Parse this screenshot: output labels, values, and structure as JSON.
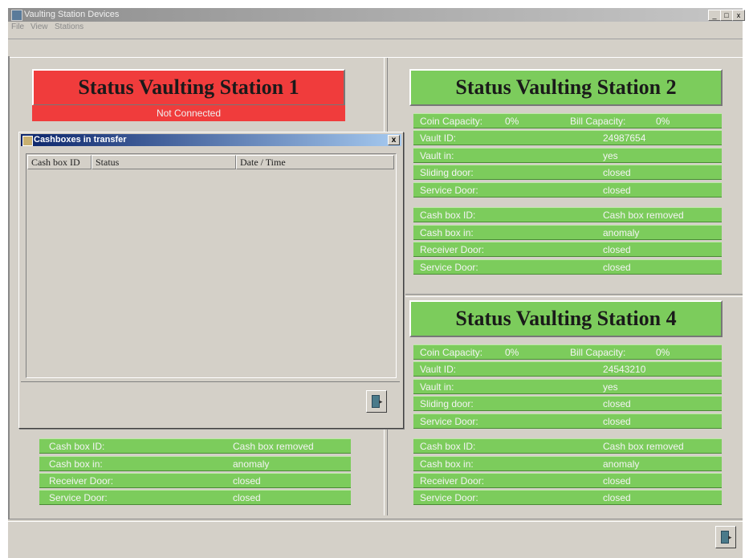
{
  "window": {
    "title": "Vaulting Station Devices",
    "controls": [
      "_",
      "□",
      "x"
    ]
  },
  "menu": [
    "File",
    "View",
    "Stations"
  ],
  "station1": {
    "header": "Status Vaulting Station 1",
    "status": "Not Connected",
    "rows": [
      {
        "label": "Cash box ID:",
        "value": "Cash box removed"
      },
      {
        "label": "Cash box in:",
        "value": "anomaly"
      },
      {
        "label": "Receiver Door:",
        "value": "closed"
      },
      {
        "label": "Service Door:",
        "value": "closed"
      }
    ]
  },
  "station2": {
    "header": "Status Vaulting Station 2",
    "capacity": {
      "coin_label": "Coin Capacity:",
      "coin_value": "0%",
      "bill_label": "Bill Capacity:",
      "bill_value": "0%"
    },
    "vault_rows": [
      {
        "label": "Vault ID:",
        "value": "24987654"
      },
      {
        "label": "Vault in:",
        "value": "yes"
      },
      {
        "label": "Sliding door:",
        "value": "closed"
      },
      {
        "label": "Service Door:",
        "value": "closed"
      }
    ],
    "cash_rows": [
      {
        "label": "Cash box ID:",
        "value": "Cash box removed"
      },
      {
        "label": "Cash box in:",
        "value": "anomaly"
      },
      {
        "label": "Receiver Door:",
        "value": "closed"
      },
      {
        "label": "Service Door:",
        "value": "closed"
      }
    ]
  },
  "station4": {
    "header": "Status Vaulting Station 4",
    "capacity": {
      "coin_label": "Coin Capacity:",
      "coin_value": "0%",
      "bill_label": "Bill Capacity:",
      "bill_value": "0%"
    },
    "vault_rows": [
      {
        "label": "Vault ID:",
        "value": "24543210"
      },
      {
        "label": "Vault in:",
        "value": "yes"
      },
      {
        "label": "Sliding door:",
        "value": "closed"
      },
      {
        "label": "Service Door:",
        "value": "closed"
      }
    ],
    "cash_rows": [
      {
        "label": "Cash box ID:",
        "value": "Cash box removed"
      },
      {
        "label": "Cash box in:",
        "value": "anomaly"
      },
      {
        "label": "Receiver Door:",
        "value": "closed"
      },
      {
        "label": "Service Door:",
        "value": "closed"
      }
    ]
  },
  "dialog": {
    "title": "Cashboxes in transfer",
    "close": "x",
    "columns": [
      "Cash box ID",
      "Status",
      "Date / Time"
    ],
    "rows": []
  },
  "colors": {
    "ok": "#7ccc5c",
    "error": "#f03c3c"
  },
  "icons": {
    "exit": "exit-door-icon"
  }
}
